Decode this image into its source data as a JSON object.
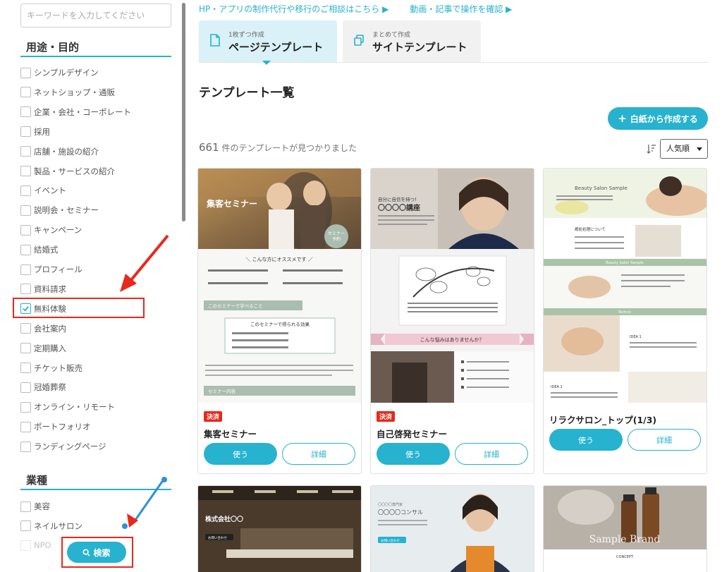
{
  "search": {
    "placeholder": "キーワードを入力してください",
    "button_label": "検索"
  },
  "purpose": {
    "heading": "用途・目的",
    "items": [
      {
        "label": "シンプルデザイン",
        "checked": false
      },
      {
        "label": "ネットショップ・通販",
        "checked": false
      },
      {
        "label": "企業・会社・コーポレート",
        "checked": false
      },
      {
        "label": "採用",
        "checked": false
      },
      {
        "label": "店舗・施設の紹介",
        "checked": false
      },
      {
        "label": "製品・サービスの紹介",
        "checked": false
      },
      {
        "label": "イベント",
        "checked": false
      },
      {
        "label": "説明会・セミナー",
        "checked": false
      },
      {
        "label": "キャンペーン",
        "checked": false
      },
      {
        "label": "結婚式",
        "checked": false
      },
      {
        "label": "プロフィール",
        "checked": false
      },
      {
        "label": "資料請求",
        "checked": false
      },
      {
        "label": "無料体験",
        "checked": true
      },
      {
        "label": "会社案内",
        "checked": false
      },
      {
        "label": "定期購入",
        "checked": false
      },
      {
        "label": "チケット販売",
        "checked": false
      },
      {
        "label": "冠婚葬祭",
        "checked": false
      },
      {
        "label": "オンライン・リモート",
        "checked": false
      },
      {
        "label": "ポートフォリオ",
        "checked": false
      },
      {
        "label": "ランディングページ",
        "checked": false
      }
    ]
  },
  "industry": {
    "heading": "業種",
    "items": [
      {
        "label": "美容",
        "checked": false
      },
      {
        "label": "ネイルサロン",
        "checked": false
      },
      {
        "label": "NPO",
        "checked": false
      }
    ]
  },
  "top_links": {
    "consult": "HP・アプリの制作代行や移行のご相談はこちら ▶",
    "video": "動画・記事で操作を確認 ▶"
  },
  "tabs": [
    {
      "small": "1枚ずつ作成",
      "big": "ページテンプレート",
      "active": true
    },
    {
      "small": "まとめて作成",
      "big": "サイトテンプレート",
      "active": false
    }
  ],
  "main": {
    "title": "テンプレート一覧",
    "blank_button": "白紙から作成する",
    "count": "661",
    "count_suffix": " 件のテンプレートが見つかりました",
    "sort_label": "人気順"
  },
  "cards": [
    {
      "badge": "決済",
      "title": "集客セミナー",
      "use_label": "使う",
      "detail_label": "詳細",
      "thumb": {
        "hero_text": "集客セミナー",
        "circle_line1": "セミナー",
        "circle_line2": "予約",
        "recommend": "＼ こんな方にオススメです ／",
        "learn_heading": "このセミナーで学べること",
        "effect_heading": "このセミナーで得られる効果",
        "content_heading": "セミナー内容"
      }
    },
    {
      "badge": "決済",
      "title": "自己啓発セミナー",
      "use_label": "使う",
      "detail_label": "詳細",
      "thumb": {
        "hero_small": "自分に自信を持つ！",
        "hero_text": "〇〇〇〇講座",
        "ribbon": "こんな悩みはありませんか？"
      }
    },
    {
      "badge": "",
      "title": "リラクサロン_トップ(1/3)",
      "use_label": "使う",
      "detail_label": "詳細",
      "thumb": {
        "hero_text": "Beauty Salon Sample",
        "section_about": "癒処処理について",
        "section_bar": "Beauty Salon Sample",
        "section_tech": "Technic",
        "label1": "IDEA 1",
        "label2": "IDEA 2"
      }
    }
  ],
  "bottom_cards": [
    {
      "hero_text": "株式会社〇〇",
      "button": "お問い合わせ"
    },
    {
      "hero_small": "〇〇〇〇専門家",
      "hero_text": "〇〇〇〇コンサル",
      "button": "お問い合わせ"
    },
    {
      "hero_text": "Sample Brand",
      "sub": "CONCEPT"
    }
  ],
  "colors": {
    "accent": "#27b2cf",
    "alert": "#e8281c",
    "sage": "#a9bdb0"
  }
}
